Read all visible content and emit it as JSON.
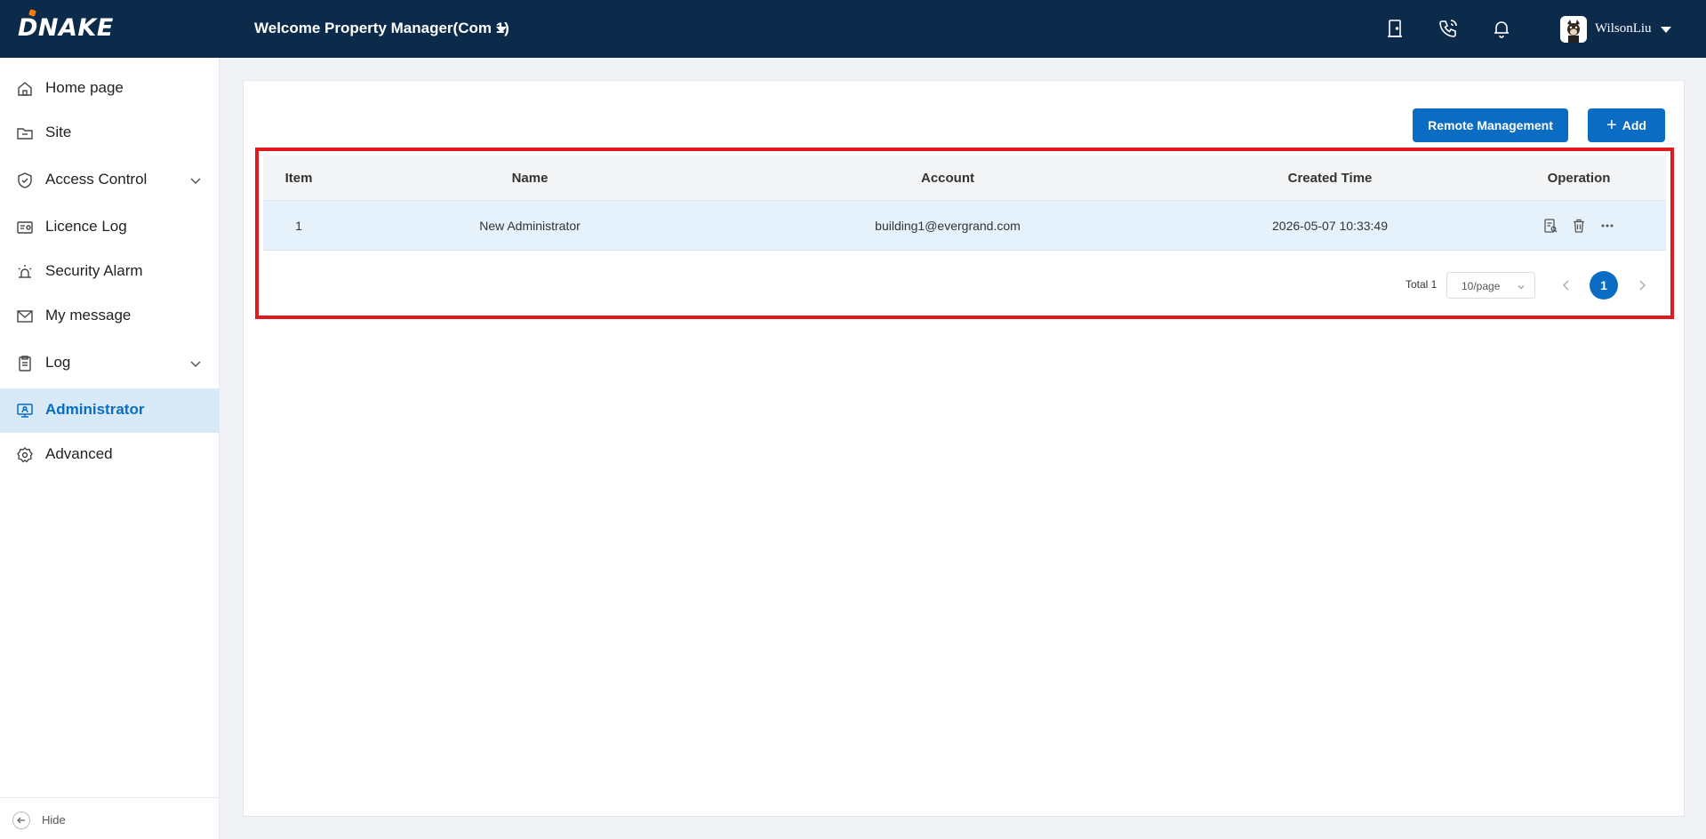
{
  "header": {
    "logo_text": "DNAKE",
    "welcome": "Welcome",
    "role": "Property Manager(Com 1)",
    "username": "WilsonLiu"
  },
  "sidebar": {
    "items": [
      {
        "label": "Home page",
        "icon": "home-icon"
      },
      {
        "label": "Site",
        "icon": "folder-icon"
      },
      {
        "label": "Access Control",
        "icon": "shield-icon",
        "expandable": true
      },
      {
        "label": "Licence Log",
        "icon": "license-icon"
      },
      {
        "label": "Security Alarm",
        "icon": "alarm-icon"
      },
      {
        "label": "My message",
        "icon": "mail-icon"
      },
      {
        "label": "Log",
        "icon": "clipboard-icon",
        "expandable": true
      },
      {
        "label": "Administrator",
        "icon": "admin-monitor-icon",
        "active": true
      },
      {
        "label": "Advanced",
        "icon": "gear-icon"
      }
    ],
    "hide_label": "Hide"
  },
  "toolbar": {
    "remote_label": "Remote Management",
    "add_label": "Add"
  },
  "table": {
    "columns": [
      "Item",
      "Name",
      "Account",
      "Created Time",
      "Operation"
    ],
    "rows": [
      {
        "item": "1",
        "name": "New Administrator",
        "account": "building1@evergrand.com",
        "created": "2026-05-07 10:33:49"
      }
    ]
  },
  "pagination": {
    "total_label": "Total 1",
    "page_size": "10/page",
    "current_page": "1"
  },
  "colors": {
    "topbar": "#0c2a4a",
    "accent": "#0a6cc2",
    "highlight": "#e0191f"
  }
}
